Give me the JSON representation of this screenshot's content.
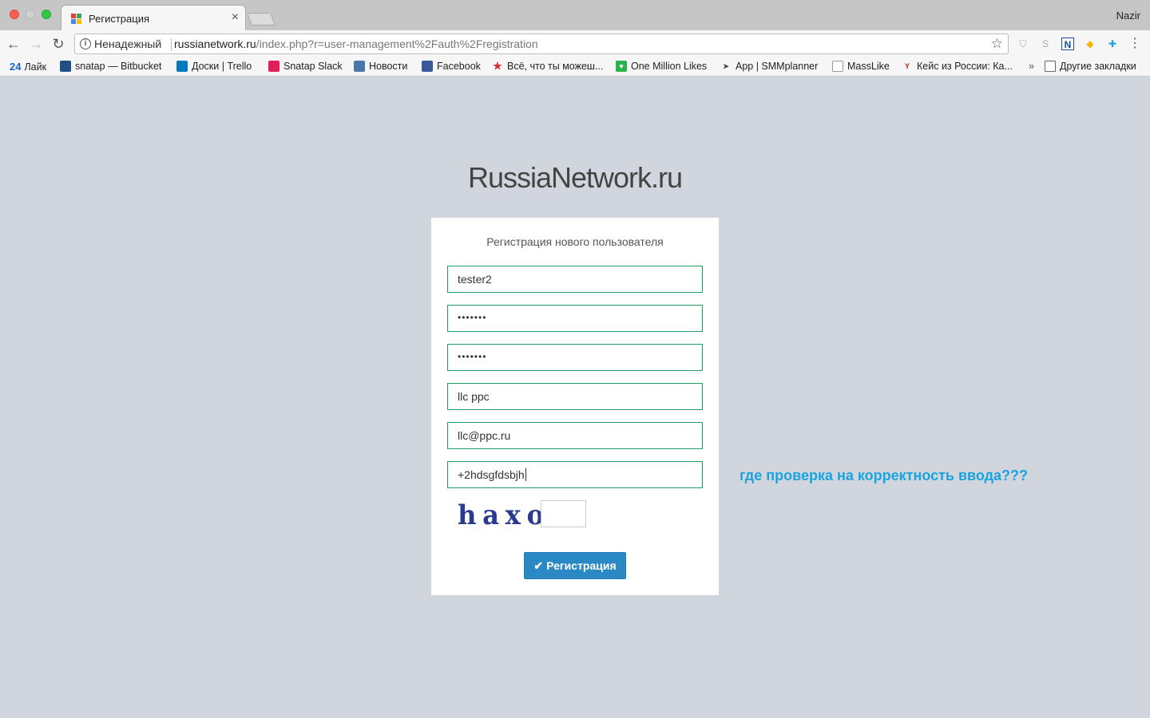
{
  "browser": {
    "tab_title": "Регистрация",
    "tab_close": "×",
    "profile_name": "Nazir",
    "nav": {
      "back": "←",
      "forward": "→",
      "reload": "↻"
    },
    "omnibox": {
      "security": "Ненадежный",
      "url_host": "russianetwork.ru",
      "url_path": "/index.php?r=user-management%2Fauth%2Fregistration"
    },
    "bookmarks": [
      {
        "label": "Лайк",
        "icon": "24"
      },
      {
        "label": "snatap — Bitbucket",
        "icon": "bitbucket-icon"
      },
      {
        "label": "Доски | Trello",
        "icon": "trello-icon"
      },
      {
        "label": "Snatap Slack",
        "icon": "slack-icon"
      },
      {
        "label": "Новости",
        "icon": "vk-icon"
      },
      {
        "label": "Facebook",
        "icon": "facebook-icon"
      },
      {
        "label": "Всё, что ты можеш...",
        "icon": "star-icon"
      },
      {
        "label": "One Million Likes",
        "icon": "heart-icon"
      },
      {
        "label": "App | SMMplanner",
        "icon": "plane-icon"
      },
      {
        "label": "MassLike",
        "icon": "page-icon"
      },
      {
        "label": "Кейс из России: Ка...",
        "icon": "yc-icon"
      },
      {
        "label": "»",
        "icon": ""
      },
      {
        "label": "Другие закладки",
        "icon": "folder-icon"
      }
    ]
  },
  "page": {
    "site_title": "RussiaNetwork.ru",
    "form": {
      "heading": "Регистрация нового пользователя",
      "username": "tester2",
      "password": "•••••••",
      "password_repeat": "•••••••",
      "company": "llc ppc",
      "email": "llc@ppc.ru",
      "phone": "+2hdsgfdsbjh",
      "captcha_text": "haxo",
      "captcha_value": "",
      "submit_icon": "✔",
      "submit_label": "Регистрация"
    },
    "annotation": "где проверка на корректность ввода???"
  },
  "colors": {
    "page_bg": "#d1d6de",
    "field_border": "#1d9d5f",
    "button_bg": "#2a89c4",
    "annotation": "#1aa3de",
    "captcha": "#2b3a91"
  }
}
